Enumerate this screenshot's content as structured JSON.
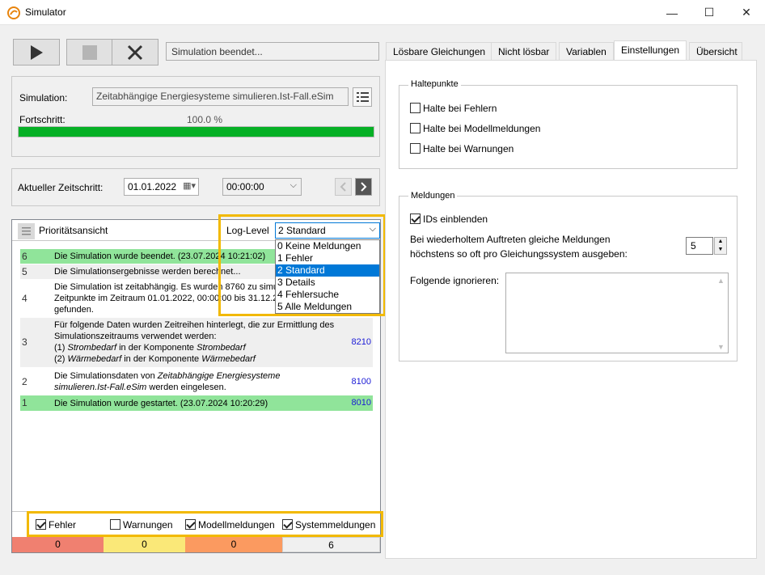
{
  "window": {
    "title": "Simulator",
    "icon": "simulator-app-icon",
    "minimize_glyph": "—",
    "maximize_glyph": "☐",
    "close_glyph": "✕"
  },
  "toolbar": {
    "play_icon": "play-icon",
    "stop_icon": "stop-icon",
    "cancel_icon": "close-icon",
    "status_text": "Simulation beendet..."
  },
  "simulation": {
    "label": "Simulation:",
    "file": "Zeitabhängige Energiesysteme simulieren.Ist-Fall.eSim",
    "progress_label": "Fortschritt:",
    "progress_text": "100.0 %",
    "progress_value": 1.0
  },
  "timestep": {
    "label": "Aktueller Zeitschritt:",
    "date": "01.01.2022",
    "time": "00:00:00"
  },
  "messages": {
    "header": "Prioritätsansicht",
    "loglevel_label": "Log-Level",
    "loglevel_selected": "2 Standard",
    "loglevel_options": [
      "0 Keine Meldungen",
      "1 Fehler",
      "2 Standard",
      "3 Details",
      "4 Fehlersuche",
      "5 Alle Meldungen"
    ],
    "rows": [
      {
        "level": "6",
        "text": "Die Simulation wurde beendet. (23.07.2024 10:21:02)",
        "code": ""
      },
      {
        "level": "5",
        "text": "Die Simulationsergebnisse werden berechnet...",
        "code": ""
      },
      {
        "level": "4",
        "text_l1": "Die Simulation ist zeitabhängig. Es wurden 8760 zu simulierende",
        "text_l2": "Zeitpunkte im Zeitraum 01.01.2022, 00:00:00 bis 31.12.2022",
        "text_l3": "gefunden.",
        "code": ""
      },
      {
        "level": "3",
        "text_l1": "Für folgende Daten wurden Zeitreihen hinterlegt, die zur Ermittlung des",
        "text_l2": "Simulationszeitraums verwendet werden:",
        "text_l3a": "(1) ",
        "text_l3b": "Strombedarf",
        "text_l3c": " in der Komponente ",
        "text_l3d": "Strombedarf",
        "text_l4a": "(2) ",
        "text_l4b": "Wärmebedarf",
        "text_l4c": " in der Komponente ",
        "text_l4d": "Wärmebedarf",
        "code": "8210"
      },
      {
        "level": "2",
        "text_l1a": "Die Simulationsdaten von ",
        "text_l1b": "Zeitabhängige Energiesysteme",
        "text_l2a": "simulieren.Ist-Fall.eSim",
        "text_l2b": " werden eingelesen.",
        "code": "8100"
      },
      {
        "level": "1",
        "text": "Die Simulation wurde gestartet. (23.07.2024 10:20:29)",
        "code": "8010"
      }
    ],
    "filters": [
      {
        "label": "Fehler",
        "checked": true
      },
      {
        "label": "Warnungen",
        "checked": false
      },
      {
        "label": "Modellmeldungen",
        "checked": true
      },
      {
        "label": "Systemmeldungen",
        "checked": true
      }
    ],
    "counts": [
      {
        "value": "0",
        "color": "#f08070"
      },
      {
        "value": "0",
        "color": "#fae878"
      },
      {
        "value": "0",
        "color": "#fb9a60"
      },
      {
        "value": "6",
        "color": "#f0f0f0"
      }
    ]
  },
  "tabs": [
    "Lösbare Gleichungen",
    "Nicht lösbar",
    "Variablen",
    "Einstellungen",
    "Übersicht"
  ],
  "active_tab": "Einstellungen",
  "settings": {
    "haltepunkte_title": "Haltepunkte",
    "halt_errors": "Halte bei Fehlern",
    "halt_model": "Halte bei Modellmeldungen",
    "halt_warnings": "Halte bei Warnungen",
    "meldungen_title": "Meldungen",
    "show_ids": "IDs einblenden",
    "repeat_l1": "Bei wiederholtem Auftreten gleiche Meldungen",
    "repeat_l2": "höchstens so oft pro Gleichungssystem ausgeben:",
    "repeat_value": "5",
    "ignore_label": "Folgende ignorieren:"
  },
  "colors": {
    "highlight": "#f2b900",
    "progress": "#06b025",
    "row_green": "#90e49a",
    "selection": "#0078d7"
  }
}
